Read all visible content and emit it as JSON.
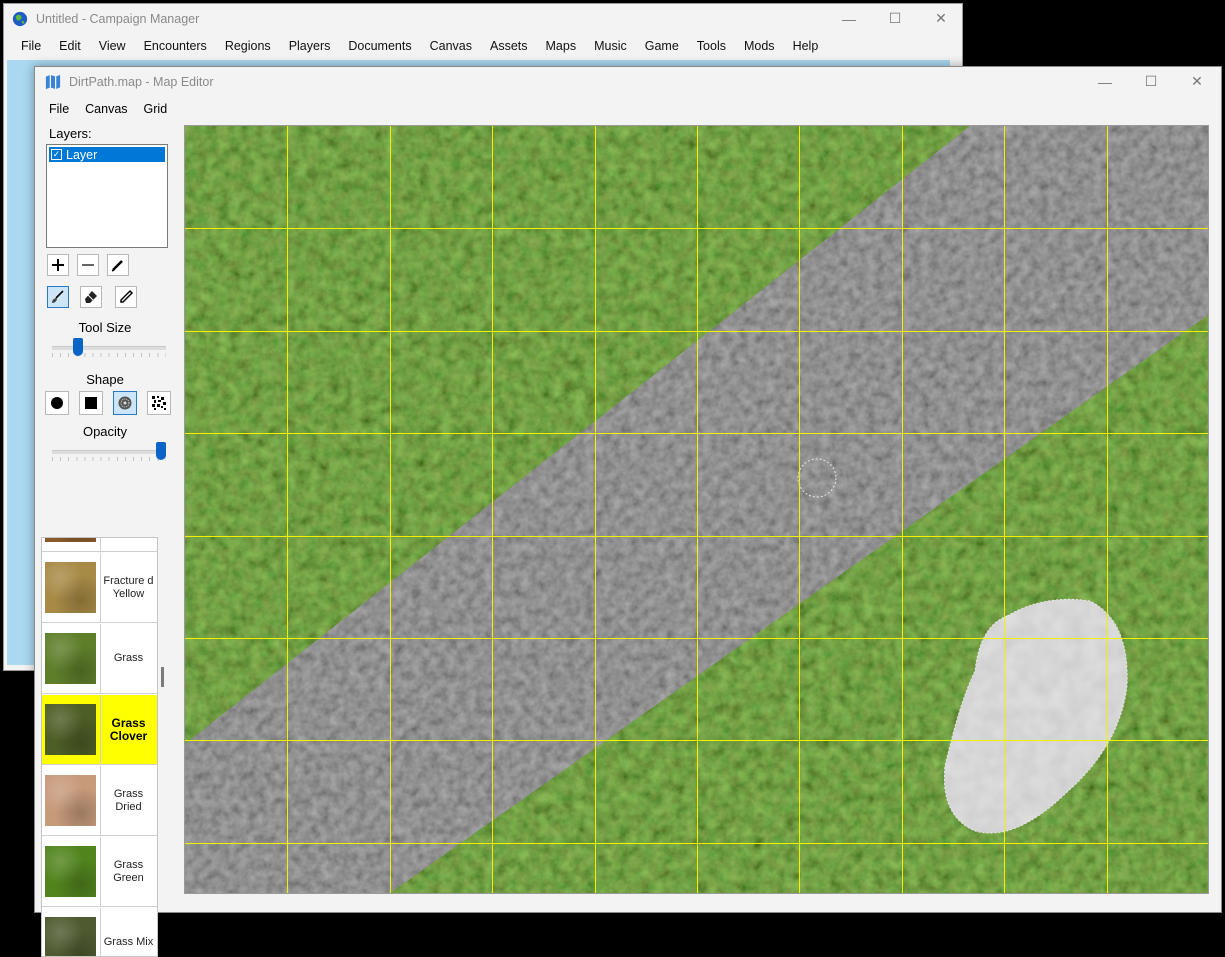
{
  "campaign_window": {
    "title": "Untitled - Campaign Manager",
    "menu": [
      "File",
      "Edit",
      "View",
      "Encounters",
      "Regions",
      "Players",
      "Documents",
      "Canvas",
      "Assets",
      "Maps",
      "Music",
      "Game",
      "Tools",
      "Mods",
      "Help"
    ],
    "controls": {
      "minimize": "—",
      "maximize": "☐",
      "close": "✕"
    }
  },
  "editor_window": {
    "title": "DirtPath.map - Map Editor",
    "menu": [
      "File",
      "Canvas",
      "Grid"
    ],
    "controls": {
      "minimize": "—",
      "maximize": "☐",
      "close": "✕"
    }
  },
  "layers": {
    "label": "Layers:",
    "items": [
      {
        "name": "Layer",
        "checked": true,
        "selected": true
      }
    ],
    "buttons": [
      "add-icon",
      "remove-icon",
      "pencil-icon"
    ]
  },
  "tools": {
    "items": [
      {
        "icon": "brush-icon",
        "selected": true
      },
      {
        "icon": "eraser-icon",
        "selected": false
      },
      {
        "icon": "eyedropper-icon",
        "selected": false
      }
    ]
  },
  "tool_size": {
    "label": "Tool Size",
    "value_fraction": 0.2
  },
  "shape": {
    "label": "Shape",
    "items": [
      {
        "icon": "circle-shape-icon",
        "selected": false
      },
      {
        "icon": "square-shape-icon",
        "selected": false
      },
      {
        "icon": "soft-brush-shape-icon",
        "selected": true
      },
      {
        "icon": "scatter-shape-icon",
        "selected": false
      }
    ]
  },
  "opacity": {
    "label": "Opacity",
    "value_fraction": 1.0
  },
  "textures": [
    {
      "label": "",
      "color": "#8a5a2a"
    },
    {
      "label": "Fracture d Yellow",
      "color": "#a88a46"
    },
    {
      "label": "Grass",
      "color": "#5e7e2a"
    },
    {
      "label": "Grass Clover",
      "color": "#4d5e26",
      "selected": true
    },
    {
      "label": "Grass Dried",
      "color": "#c79a7a"
    },
    {
      "label": "Grass Green",
      "color": "#52841e"
    },
    {
      "label": "Grass Mix",
      "color": "#4f5a30"
    }
  ],
  "map": {
    "grid_color": "#f2f200",
    "grass_color": "#4f6e2a",
    "path_color": "#6b6b6b",
    "rock_color": "#c9c9c9"
  }
}
